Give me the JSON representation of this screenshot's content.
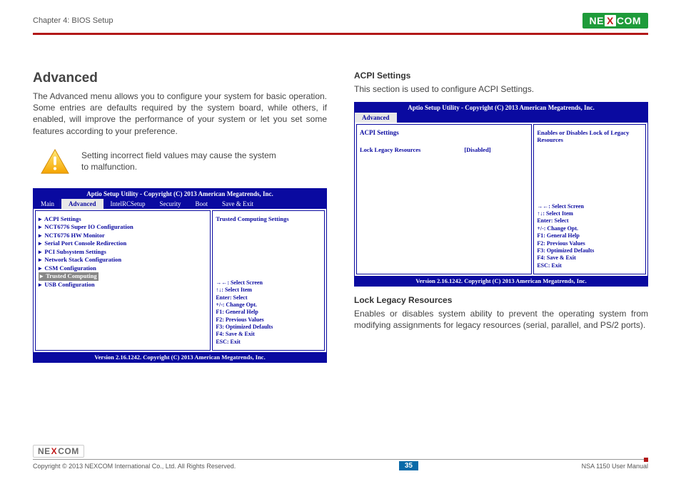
{
  "header": {
    "chapter": "Chapter 4: BIOS Setup",
    "brand_pre": "NE",
    "brand_x": "X",
    "brand_post": "COM"
  },
  "left": {
    "title": "Advanced",
    "intro": "The Advanced menu allows you to configure your system for basic operation. Some entries are defaults required by the system board, while others, if enabled, will improve the performance of your system or let you set some features according to your preference.",
    "warn": "Setting incorrect field values may cause the system to malfunction."
  },
  "right": {
    "h2a": "ACPI Settings",
    "desc": "This section is used to configure ACPI Settings.",
    "h2b": "Lock Legacy Resources",
    "desc2": "Enables or disables system ability to prevent the operating system from modifying assignments for legacy resources (serial, parallel, and PS/2 ports)."
  },
  "bios1": {
    "title": "Aptio Setup Utility - Copyright (C) 2013 American Megatrends, Inc.",
    "tabs": [
      "Main",
      "Advanced",
      "IntelRCSetup",
      "Security",
      "Boot",
      "Save & Exit"
    ],
    "items": [
      "ACPI Settings",
      "NCT6776 Super IO Configuration",
      "NCT6776 HW Monitor",
      "Serial Port Console Redirection",
      "PCI Subsystem Settings",
      "Network Stack Configuration",
      "CSM Configuration",
      "Trusted Computing",
      "USB Configuration"
    ],
    "selected_index": 7,
    "right_desc": "Trusted Computing Settings",
    "help": [
      "→←: Select Screen",
      "↑↓: Select Item",
      "Enter: Select",
      "+/-: Change Opt.",
      "F1: General Help",
      "F2: Previous Values",
      "F3: Optimized Defaults",
      "F4: Save & Exit",
      "ESC: Exit"
    ],
    "footer": "Version 2.16.1242. Copyright (C) 2013 American Megatrends, Inc."
  },
  "bios2": {
    "title": "Aptio Setup Utility - Copyright (C) 2013 American Megatrends, Inc.",
    "tab": "Advanced",
    "section_title": "ACPI Settings",
    "row_label": "Lock Legacy Resources",
    "row_value": "[Disabled]",
    "right_desc": "Enables or Disables Lock of Legacy Resources",
    "help": [
      "→←: Select Screen",
      "↑↓: Select Item",
      "Enter: Select",
      "+/-: Change Opt.",
      "F1: General Help",
      "F2: Previous Values",
      "F3: Optimized Defaults",
      "F4: Save & Exit",
      "ESC: Exit"
    ],
    "footer": "Version 2.16.1242. Copyright (C) 2013 American Megatrends, Inc."
  },
  "footer": {
    "brand_pre": "NE",
    "brand_x": "X",
    "brand_post": "COM",
    "copyright": "Copyright © 2013 NEXCOM International Co., Ltd. All Rights Reserved.",
    "page": "35",
    "doc": "NSA 1150 User Manual"
  }
}
